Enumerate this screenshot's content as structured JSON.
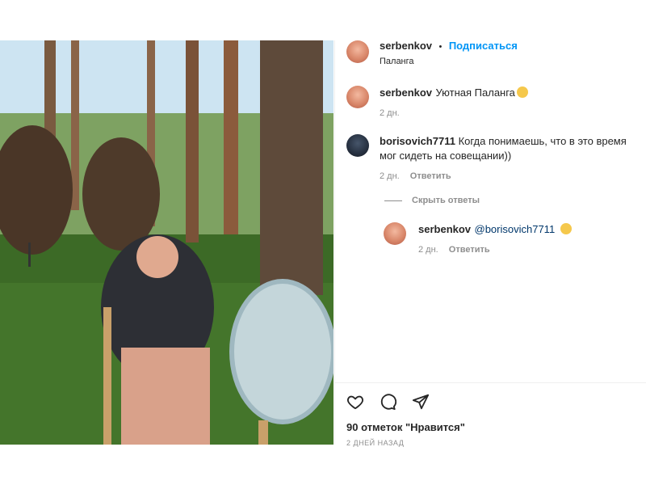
{
  "author": {
    "username": "serbenkov",
    "separator": "•",
    "follow_label": "Подписаться",
    "location": "Паланга"
  },
  "caption": {
    "username": "serbenkov",
    "text": "Уютная Паланга",
    "time": "2 дн."
  },
  "comments": [
    {
      "username": "borisovich7711",
      "text": "Когда понимаешь, что в это время мог сидеть на совещании))",
      "time": "2 дн.",
      "reply_label": "Ответить"
    }
  ],
  "hide_replies_label": "Скрыть ответы",
  "reply": {
    "username": "serbenkov",
    "text": "@borisovich7711",
    "time": "2 дн.",
    "reply_label": "Ответить"
  },
  "likes_text": "90 отметок \"Нравится\"",
  "posted_ago": "2 ДНЕЙ НАЗАД",
  "colors": {
    "link": "#0095f6",
    "muted": "#8e8e8e",
    "text": "#262626"
  },
  "icons": [
    "heart-icon",
    "comment-icon",
    "share-icon",
    "smile-emoji"
  ]
}
